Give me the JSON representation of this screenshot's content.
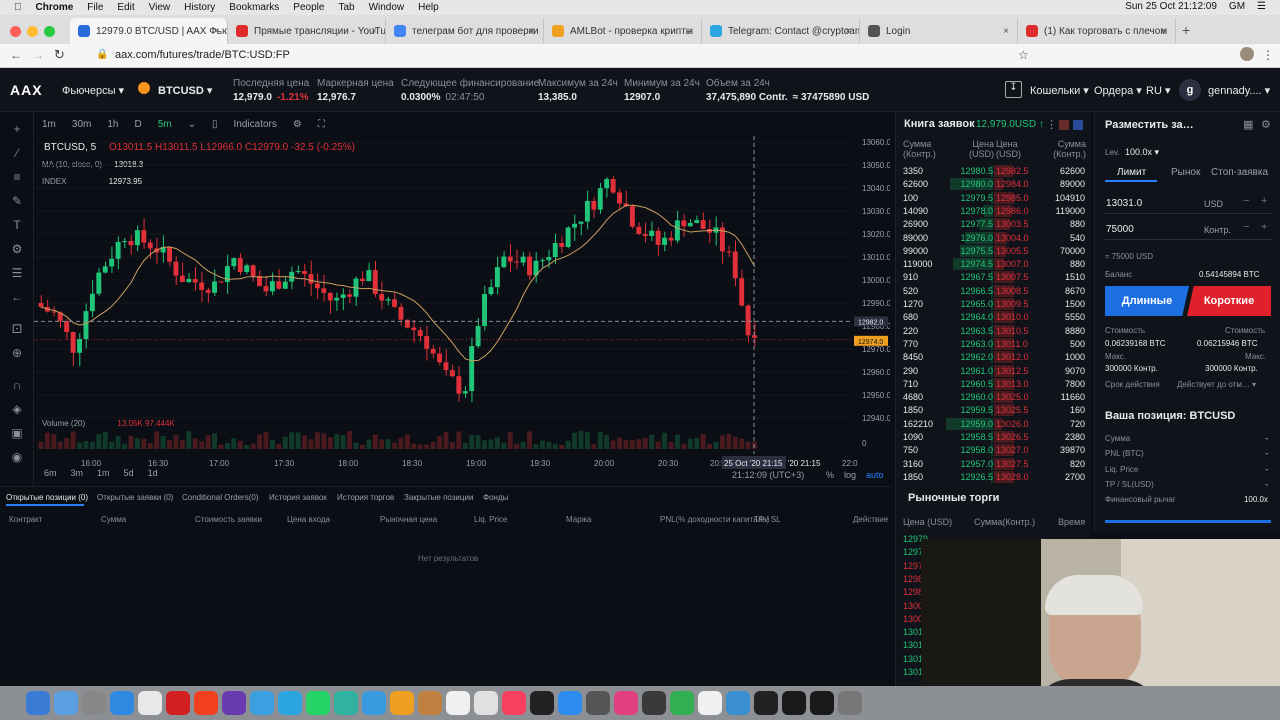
{
  "menubar": {
    "items": [
      "Chrome",
      "File",
      "Edit",
      "View",
      "History",
      "Bookmarks",
      "People",
      "Tab",
      "Window",
      "Help"
    ],
    "right": [
      "Sun 25 Oct 21:12:09",
      "GM"
    ]
  },
  "tabs": [
    {
      "title": "12979.0 BTC/USD | AAX Фьючерсы",
      "color": "#2a6bd9"
    },
    {
      "title": "Прямые трансляции - YouTube",
      "color": "#e02b2b"
    },
    {
      "title": "телеграм бот для проверки",
      "color": "#4285f4"
    },
    {
      "title": "AMLBot - проверка крипты",
      "color": "#f0a020"
    },
    {
      "title": "Telegram: Contact @cryptoamlbot",
      "color": "#2ca5e0"
    },
    {
      "title": "Login",
      "color": "#555555"
    },
    {
      "title": "(1) Как торговать с плечом",
      "color": "#e02b2b"
    }
  ],
  "address": {
    "url": "aax.com/futures/trade/BTC:USD:FP"
  },
  "app": {
    "logo": "AAX",
    "product": "Фьючерсы ▾",
    "symbol": "BTCUSD ▾",
    "stats": [
      {
        "label": "Последняя цена",
        "value": "12,979.0",
        "extra": "-1.21%"
      },
      {
        "label": "Маркерная цена",
        "value": "12,976.7",
        "extra": ""
      },
      {
        "label": "Следующее финансирование",
        "value": "0.0300%",
        "extra": "02:47:50"
      },
      {
        "label": "Максимум за 24ч",
        "value": "13,385.0",
        "extra": ""
      },
      {
        "label": "Минимум за 24ч",
        "value": "12907.0",
        "extra": ""
      },
      {
        "label": "Объем за 24ч",
        "value": "37,475,890 Contr.",
        "extra": "≈ 37475890 USD"
      }
    ],
    "right": {
      "wallet": "Кошельки ▾",
      "orders": "Ордера ▾",
      "lang": "RU ▾",
      "user": "gennady.... ▾"
    }
  },
  "chart": {
    "intervals": [
      "1m",
      "30m",
      "1h",
      "D",
      "5m"
    ],
    "indicators": "Indicators",
    "symbol": "BTCUSD, 5",
    "ohlc": "O13011.5 H13011.5 L12966.0 C12979.0 -32.5 (-0.25%)",
    "ma": "MA (10, close, 0)",
    "ma_value": "13018.3",
    "index": "INDEX",
    "index_value": "12973.95",
    "volume": "Volume (20)",
    "vol_values": "13.05K 97.444K",
    "time_labels": [
      "16:00",
      "16:30",
      "17:00",
      "17:30",
      "18:00",
      "18:30",
      "19:00",
      "19:30",
      "20:00",
      "20:30",
      "20:55",
      "25 Oct '20  21:15",
      "22:0"
    ],
    "price_labels": [
      "13060.0",
      "13050.0",
      "13040.0",
      "13030.0",
      "13020.0",
      "13010.0",
      "13000.0",
      "12990.0",
      "12980.0",
      "12970.0",
      "12960.0",
      "12950.0",
      "12940.0",
      "0"
    ],
    "tags": [
      "12982.0",
      "12974.0"
    ],
    "ranges": [
      "6m",
      "3m",
      "1m",
      "5d",
      "1d"
    ],
    "clock": "21:12:09 (UTC+3)",
    "opts": [
      "%",
      "log",
      "auto"
    ]
  },
  "chart_data": {
    "type": "candlestick",
    "x_range": [
      "15:50",
      "22:00"
    ],
    "ylim": [
      12940,
      13060
    ],
    "last_close": 12979.0
  },
  "positions": {
    "tabs": [
      "Открытые позиции (0)",
      "Открытые заявки (0)",
      "Conditional Orders(0)",
      "История заявок",
      "История торгов",
      "Закрытые позиции",
      "Фонды"
    ],
    "headers": [
      "Контракт",
      "Сумма",
      "Стоимость заявки",
      "Цена входа",
      "Рыночная цена",
      "Liq. Price",
      "Маржа",
      "PNL(% доходности капитала)",
      "TP / SL",
      "Действие"
    ],
    "empty": "Нет результатов"
  },
  "orderbook": {
    "title": "Книга заявок",
    "last": "12,979.0USD ↑",
    "headers": [
      "Сумма (Контр.)",
      "Цена (USD)",
      "Цена (USD)",
      "Сумма (Контр.)"
    ],
    "rows": [
      [
        "3350",
        "12980.5",
        "12982.5",
        "62600"
      ],
      [
        "62600",
        "12980.0",
        "12984.0",
        "89000"
      ],
      [
        "100",
        "12979.5",
        "12985.0",
        "104910"
      ],
      [
        "14090",
        "12978.0",
        "12986.0",
        "119000"
      ],
      [
        "26900",
        "12977.5",
        "13003.5",
        "880"
      ],
      [
        "89000",
        "12976.0",
        "13004.0",
        "540"
      ],
      [
        "99000",
        "12975.5",
        "13005.5",
        "70000"
      ],
      [
        "119000",
        "12974.5",
        "13007.0",
        "880"
      ],
      [
        "910",
        "12967.5",
        "13007.5",
        "1510"
      ],
      [
        "520",
        "12966.5",
        "13008.5",
        "8670"
      ],
      [
        "1270",
        "12965.0",
        "13009.5",
        "1500"
      ],
      [
        "680",
        "12964.0",
        "13010.0",
        "5550"
      ],
      [
        "220",
        "12963.5",
        "13010.5",
        "8880"
      ],
      [
        "770",
        "12963.0",
        "13011.0",
        "500"
      ],
      [
        "8450",
        "12962.0",
        "13012.0",
        "1000"
      ],
      [
        "290",
        "12961.0",
        "13012.5",
        "9070"
      ],
      [
        "710",
        "12960.5",
        "13013.0",
        "7800"
      ],
      [
        "4680",
        "12960.0",
        "13025.0",
        "11660"
      ],
      [
        "1850",
        "12959.5",
        "13025.5",
        "160"
      ],
      [
        "162210",
        "12959.0",
        "13026.0",
        "720"
      ],
      [
        "1090",
        "12958.5",
        "13026.5",
        "2380"
      ],
      [
        "750",
        "12958.0",
        "13027.0",
        "39870"
      ],
      [
        "3160",
        "12957.0",
        "13027.5",
        "820"
      ],
      [
        "1850",
        "12926.5",
        "13028.0",
        "2700"
      ]
    ],
    "depth": [
      0.05,
      0.9,
      0.01,
      0.2,
      0.3,
      0.6,
      0.7,
      0.85,
      0.02,
      0.02,
      0.03,
      0.02,
      0.01,
      0.02,
      0.05,
      0.02,
      0.03,
      0.05,
      0.02,
      1.0,
      0.02,
      0.02,
      0.03,
      0.02
    ]
  },
  "trades": {
    "title": "Рыночные торги",
    "headers": [
      "Цена (USD)",
      "Сумма(Контр.)",
      "Время"
    ],
    "rows": [
      "12979",
      "12979",
      "1297",
      "1298",
      "1298",
      "1300",
      "1300",
      "1301",
      "1301",
      "1301",
      "1301"
    ]
  },
  "order": {
    "title": "Разместить за…",
    "lev": "Lev.",
    "lev_value": "100.0x ▾",
    "tabs": [
      "Лимит",
      "Рынок",
      "Стоп-заявка"
    ],
    "price": "13031.0",
    "price_unit": "USD",
    "qty": "75000",
    "qty_unit": "Контр.",
    "approx": "≈ 75000 USD",
    "balance_label": "Баланс",
    "balance": "0.54145894 BTC",
    "long": "Длинные",
    "short": "Короткие",
    "cost_label": "Стоимость",
    "cost_long": "0.06239168 BTC",
    "cost_short": "0.06215946 BTC",
    "max_label": "Макс.",
    "max_long": "300000 Контр.",
    "max_short": "300000 Контр.",
    "expiry_label": "Срок действия",
    "expiry": "Действует до отм… ▾",
    "position_title": "Ваша позиция: BTCUSD",
    "pos_rows": [
      [
        "Сумма",
        "-"
      ],
      [
        "PNL (BTC)",
        "-"
      ],
      [
        "Liq. Price",
        "-"
      ],
      [
        "TP / SL(USD)",
        "-"
      ],
      [
        "Финансовый рычаг",
        "100.0x"
      ]
    ]
  },
  "colors": {
    "up": "#1fc67a",
    "down": "#e0303a",
    "long": "#1c6fe0",
    "short": "#e0202a"
  }
}
